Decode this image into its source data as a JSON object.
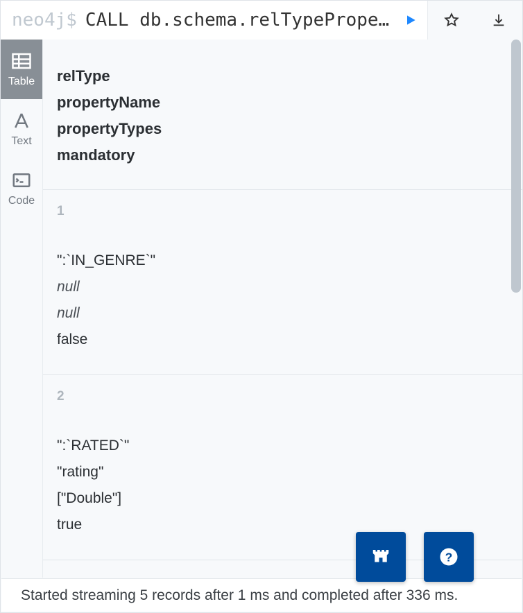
{
  "prompt": "neo4j$",
  "query": "CALL db.schema.relTypePrope…",
  "view_tabs": {
    "table": "Table",
    "text": "Text",
    "code": "Code"
  },
  "columns": {
    "c0": "relType",
    "c1": "propertyName",
    "c2": "propertyTypes",
    "c3": "mandatory"
  },
  "rows": [
    {
      "idx": "1",
      "relType": "\":`IN_GENRE`\"",
      "propertyName": "null",
      "propertyTypes": "null",
      "mandatory": "false",
      "propertyName_null": true,
      "propertyTypes_null": true
    },
    {
      "idx": "2",
      "relType": "\":`RATED`\"",
      "propertyName": "\"rating\"",
      "propertyTypes": "[\"Double\"]",
      "mandatory": "true",
      "propertyName_null": false,
      "propertyTypes_null": false
    }
  ],
  "status": "Started streaming 5 records after 1 ms and completed after 336 ms."
}
